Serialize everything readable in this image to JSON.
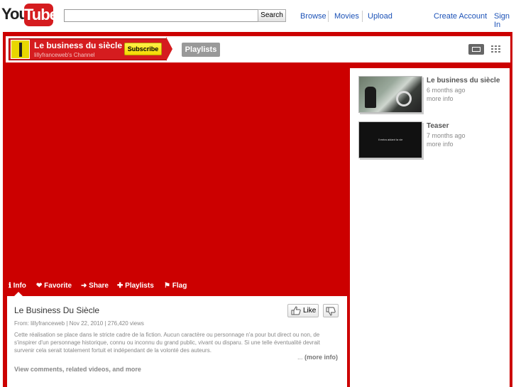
{
  "logo": {
    "you": "You",
    "tube": "Tube"
  },
  "search": {
    "value": "",
    "button": "Search"
  },
  "nav": {
    "browse": "Browse",
    "movies": "Movies",
    "upload": "Upload",
    "create_account": "Create Account",
    "sign_in": "Sign In"
  },
  "channel": {
    "title": "Le business du siècle",
    "subtitle": "lillyfranceweb's Channel",
    "subscribe": "Subscribe",
    "playlists_tab": "Playlists",
    "colors": {
      "background": "#cc0000",
      "subscribe": "#f5d900",
      "link": "#1c52b7"
    }
  },
  "sidebar": {
    "videos": [
      {
        "title": "Le business du siècle",
        "age": "6 months ago",
        "more": "more info",
        "icon": "car-scene-thumbnail"
      },
      {
        "title": "Teaser",
        "age": "7 months ago",
        "more": "more info",
        "icon": "black-title-card-thumbnail",
        "thumb_text": "Il entra aidant la vie"
      }
    ]
  },
  "actions": {
    "info": "Info",
    "favorite": "Favorite",
    "share": "Share",
    "playlists": "Playlists",
    "flag": "Flag"
  },
  "video": {
    "title": "Le Business Du Siècle",
    "meta": "From: lillyfranceweb  | Nov 22, 2010  | 276,420 views",
    "like": "Like",
    "description": "Cette réalisation se place dans le stricte cadre de la fiction. Aucun caractère ou personnage n'a pour but direct ou non, de s'inspirer d'un personnage historique, connu ou inconnu du grand public, vivant ou disparu. Si une telle éventualité devrait survenir cela serait totalement fortuit et indépendant de la volonté des auteurs.",
    "more_prefix": "...",
    "more_info": "(more info)",
    "view_comments": "View comments, related videos, and more"
  }
}
